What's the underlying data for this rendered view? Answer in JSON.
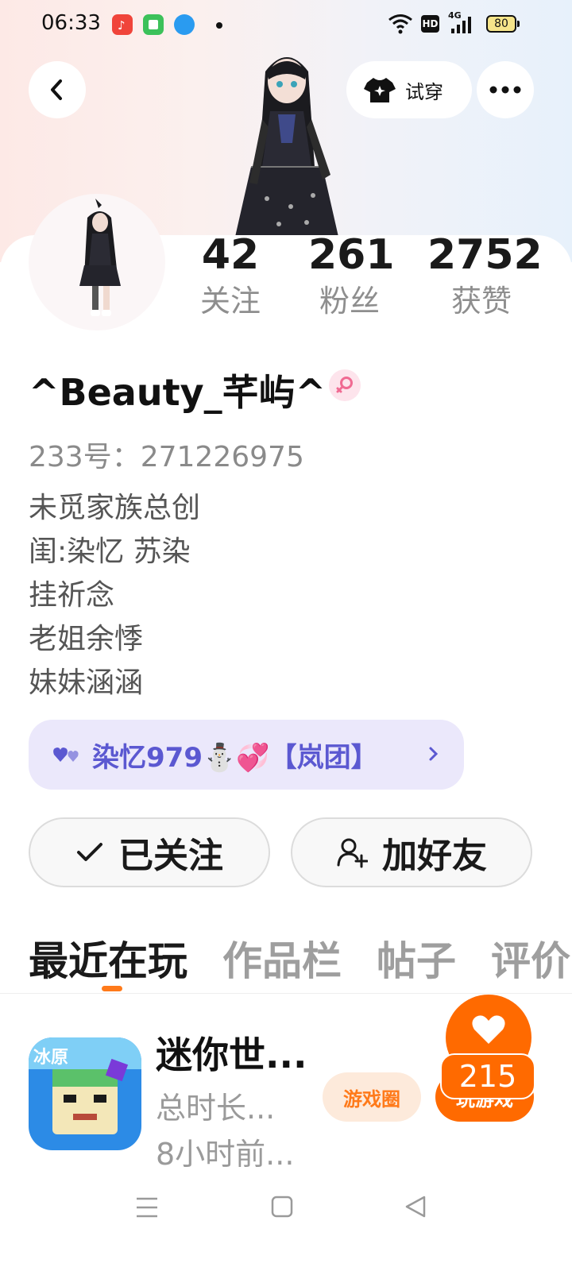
{
  "status_bar": {
    "time": "06:33",
    "hd": "HD",
    "network": "4G",
    "battery": "80",
    "icons": [
      "music-app-icon",
      "green-app-icon",
      "blue-app-icon",
      "notification-dot",
      "wifi-icon",
      "signal-icon"
    ]
  },
  "header": {
    "back_icon": "back-arrow-icon",
    "tryon_label": "试穿",
    "tryon_icon": "shirt-icon",
    "more_icon": "more-dots-icon"
  },
  "profile": {
    "stats": [
      {
        "value": "42",
        "label": "关注"
      },
      {
        "value": "261",
        "label": "粉丝"
      },
      {
        "value": "2752",
        "label": "获赞"
      }
    ],
    "name": "^Beauty_芊屿^",
    "gender_icon": "female-icon",
    "uid": "233号：271226975",
    "bio": [
      "未觅家族总创",
      "闺:染忆 苏染",
      "挂祈念",
      "老姐余悸",
      "妹妹涵涵"
    ]
  },
  "clan": {
    "label": "染忆979⛄💞【岚团】",
    "icon": "hearts-icon"
  },
  "actions": {
    "follow_label": "已关注",
    "add_friend_label": "加好友"
  },
  "tabs": [
    "最近在玩",
    "作品栏",
    "帖子",
    "评价"
  ],
  "recent_game": {
    "name": "迷你世...",
    "duration": "总时长...",
    "last_played": "8小时前...",
    "icon_label": "冰原",
    "circle_label": "游戏圈",
    "play_label": "玩游戏",
    "like_count": "215"
  },
  "colors": {
    "accent": "#ff6a00",
    "clan_bg": "#ebe8fb",
    "clan_text": "#5b58d1"
  }
}
